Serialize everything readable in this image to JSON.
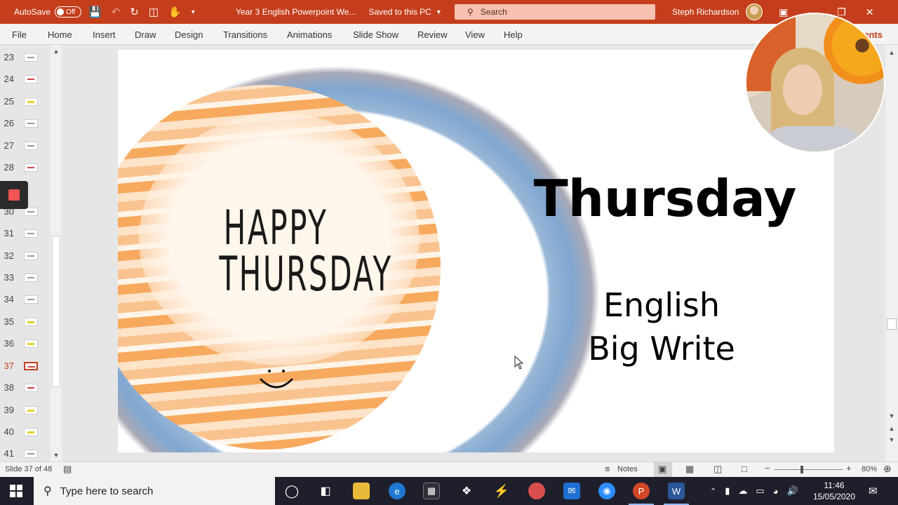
{
  "titlebar": {
    "autosave_label": "AutoSave",
    "autosave_state": "Off",
    "doc_title": "Year 3 English Powerpoint We...",
    "save_status": "Saved to this PC",
    "search_placeholder": "Search",
    "user_name": "Steph Richardson"
  },
  "menu": {
    "file": "File",
    "home": "Home",
    "insert": "Insert",
    "draw": "Draw",
    "design": "Design",
    "transitions": "Transitions",
    "animations": "Animations",
    "slideshow": "Slide Show",
    "review": "Review",
    "view": "View",
    "help": "Help",
    "comments": "ents"
  },
  "thumbnails": {
    "n23": "23",
    "n24": "24",
    "n25": "25",
    "n26": "26",
    "n27": "27",
    "n28": "28",
    "n30": "30",
    "n31": "31",
    "n32": "32",
    "n33": "33",
    "n34": "34",
    "n35": "35",
    "n36": "36",
    "n37": "37",
    "n38": "38",
    "n39": "39",
    "n40": "40",
    "n41": "41"
  },
  "slide": {
    "happy_line1": "HAPPY",
    "happy_line2": "THURSDAY",
    "title": "Thursday",
    "sub_line1": "English",
    "sub_line2": "Big Write"
  },
  "statusbar": {
    "slide_info": "Slide 37 of 48",
    "notes": "Notes",
    "zoom": "80%"
  },
  "taskbar": {
    "search_placeholder": "Type here to search",
    "time": "11:46",
    "date": "15/05/2020"
  },
  "colors": {
    "accent": "#c43e1c",
    "taskbar": "#1f1f2b"
  }
}
